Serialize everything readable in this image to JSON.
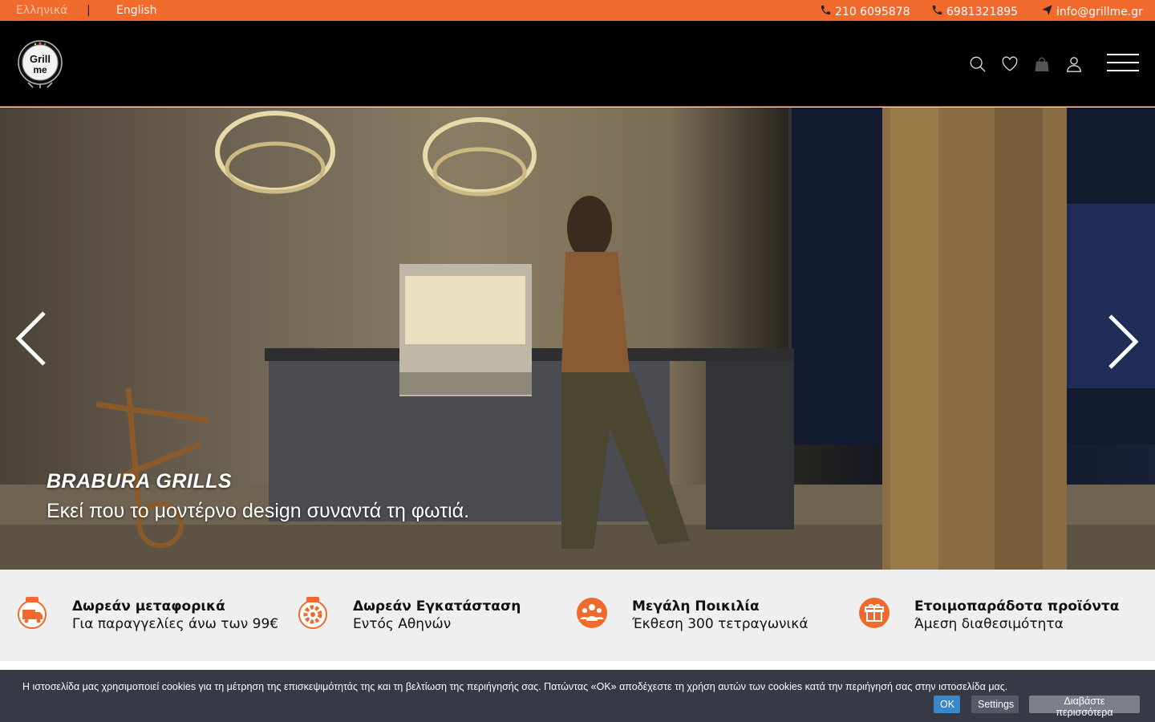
{
  "topbar": {
    "lang_greek": "Ελληνικά",
    "separator": "|",
    "lang_english": "English",
    "phone1": "210 6095878",
    "phone2": "6981321895",
    "email": "info@grillme.gr"
  },
  "header": {
    "logo_text_top": "Grill",
    "logo_text_bottom": "me",
    "icons": [
      "search-icon",
      "heart-icon",
      "cart-icon",
      "user-icon",
      "menu-icon"
    ]
  },
  "hero": {
    "title": "BRABURA GRILLS",
    "subtitle": "Εκεί που το μοντέρνο design συναντά τη φωτιά."
  },
  "features": [
    {
      "icon": "free-delivery-icon",
      "title": "Δωρεάν μεταφορικά",
      "subtitle": "Για παραγγελίες άνω των 99€"
    },
    {
      "icon": "free-installation-icon",
      "title": "Δωρεάν Εγκατάσταση",
      "subtitle": "Εντός Αθηνών"
    },
    {
      "icon": "variety-icon",
      "title": "Μεγάλη Ποικιλία",
      "subtitle": "Έκθεση 300 τετραγωνικά"
    },
    {
      "icon": "gift-icon",
      "title": "Ετοιμοπαράδοτα προϊόντα",
      "subtitle": "Άμεση διαθεσιμότητα"
    }
  ],
  "cookie": {
    "text": "Η ιστοσελίδα μας χρησιμοποιεί cookies για τη μέτρηση της επισκεψιμότητάς της και τη βελτίωση της περιήγησής σας. Πατώντας «ΟΚ» αποδέχεστε τη χρήση αυτών των cookies κατά την περιήγησή σας στην ιστοσελίδα μας.",
    "ok_label": "OK",
    "settings_label": "Settings",
    "read_more_label": "Διαβάστε περισσότερα"
  },
  "colors": {
    "accent": "#ef6a2c",
    "header_bg": "#000000",
    "features_bg": "#efefef",
    "cookie_bg": "#353a45",
    "ok_button": "#3a86c8"
  }
}
